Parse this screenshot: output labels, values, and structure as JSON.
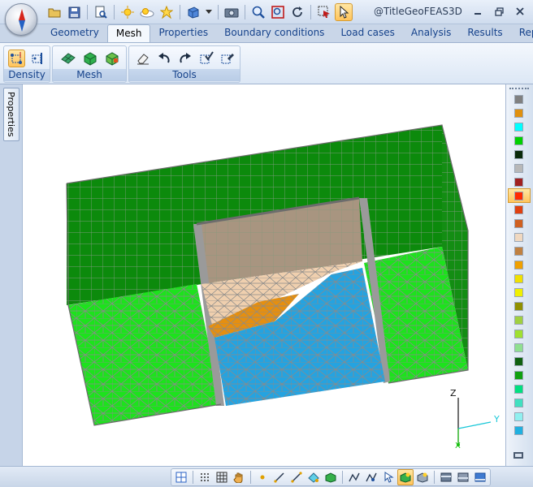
{
  "window": {
    "title": "@TitleGeoFEAS3D",
    "controls": [
      "minimize-icon",
      "restore-icon",
      "close-icon"
    ]
  },
  "quick_access": [
    "open-folder-icon",
    "save-icon",
    "print-preview-icon",
    "sun-icon",
    "cloud-icon",
    "star-icon",
    "cube-icon",
    "dropdown-icon",
    "camera-icon",
    "zoom-icon",
    "zoom-window-icon",
    "rotate-icon",
    "select-region-icon",
    "pointer-icon"
  ],
  "tabs": [
    {
      "label": "Geometry",
      "active": false
    },
    {
      "label": "Mesh",
      "active": true
    },
    {
      "label": "Properties",
      "active": false
    },
    {
      "label": "Boundary conditions",
      "active": false
    },
    {
      "label": "Load cases",
      "active": false
    },
    {
      "label": "Analysis",
      "active": false
    },
    {
      "label": "Results",
      "active": false
    },
    {
      "label": "Reports",
      "active": false
    }
  ],
  "ribbon": {
    "groups": [
      {
        "label": "Density",
        "buttons": [
          "density-node-icon",
          "density-edge-icon"
        ]
      },
      {
        "label": "Mesh",
        "buttons": [
          "mesh-surface-icon",
          "mesh-volume-icon",
          "mesh-refine-icon"
        ]
      },
      {
        "label": "Tools",
        "buttons": [
          "eraser-icon",
          "undo-icon",
          "redo-icon",
          "check-mesh-icon",
          "mesh-settings-icon"
        ]
      }
    ]
  },
  "side_panel": {
    "tab_label": "Properties"
  },
  "axis": {
    "x": "X",
    "y": "Y",
    "z": "Z"
  },
  "palette": {
    "colors": [
      "#808080",
      "#e0900e",
      "#00ffff",
      "#00d000",
      "#0a2a0a",
      "#b8b8b8",
      "#a02020",
      "#ff2a00",
      "#e04010",
      "#d06020",
      "#f0d8c0",
      "#c08040",
      "#f0a000",
      "#f0e000",
      "#f0f000",
      "#909000",
      "#a0d040",
      "#a0e030",
      "#90e090",
      "#106010",
      "#10a010",
      "#00e080",
      "#40e0c0",
      "#90f0f0",
      "#20b0e0"
    ],
    "selected_index": 7
  },
  "bottom_toolbar": [
    "grid-icon",
    "dot-grid-icon",
    "table-grid-icon",
    "hand-icon",
    "point-icon",
    "line-icon",
    "segment-icon",
    "fill-icon",
    "solid-icon",
    "node-icon",
    "node-edit-icon",
    "node-move-icon",
    "view-shaded-icon",
    "view-wire-icon",
    "display-1-icon",
    "display-2-icon",
    "display-3-icon"
  ],
  "bottom_toolbar_active": [
    13
  ]
}
